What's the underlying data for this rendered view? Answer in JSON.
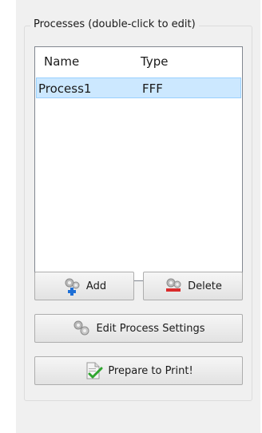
{
  "processes_group": {
    "title": "Processes (double-click to edit)"
  },
  "process_list": {
    "columns": [
      "Name",
      "Type"
    ],
    "rows": [
      {
        "name": "Process1",
        "type": "FFF",
        "selected": true
      }
    ],
    "selection_color": "#cce8ff"
  },
  "buttons": {
    "add_label": "Add",
    "add_icon": "gears-add-icon",
    "delete_label": "Delete",
    "delete_icon": "gears-delete-icon",
    "edit_label": "Edit Process Settings",
    "edit_icon": "gears-settings-icon",
    "print_label": "Prepare to Print!",
    "print_icon": "document-check-icon"
  }
}
